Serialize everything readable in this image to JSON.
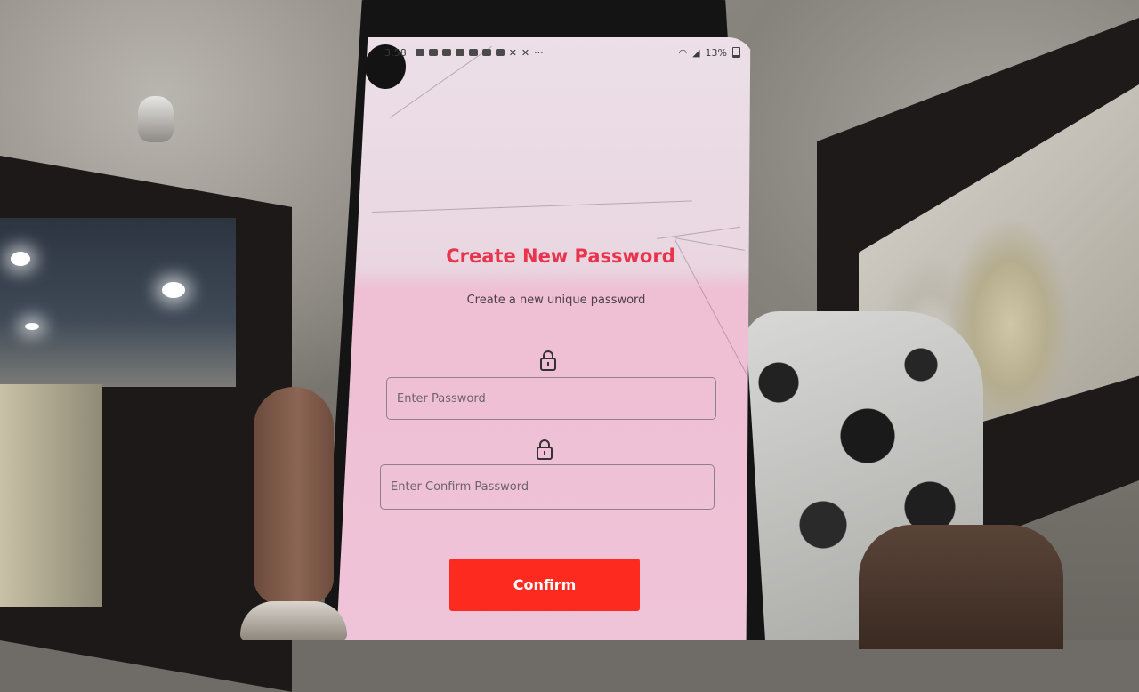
{
  "status_bar": {
    "time": "3:58",
    "overflow": "···",
    "battery": "13%"
  },
  "screen": {
    "title": "Create New Password",
    "subtitle": "Create a new unique password",
    "password": {
      "icon": "lock-icon",
      "placeholder": "Enter Password",
      "value": ""
    },
    "confirm_password": {
      "icon": "lock-icon",
      "placeholder": "Enter Confirm Password",
      "value": ""
    },
    "confirm_button": "Confirm"
  },
  "colors": {
    "title": "#e8344c",
    "button": "#fd2b1f",
    "background_top": "#ecdfe7",
    "background_bottom": "#efc3d8"
  }
}
